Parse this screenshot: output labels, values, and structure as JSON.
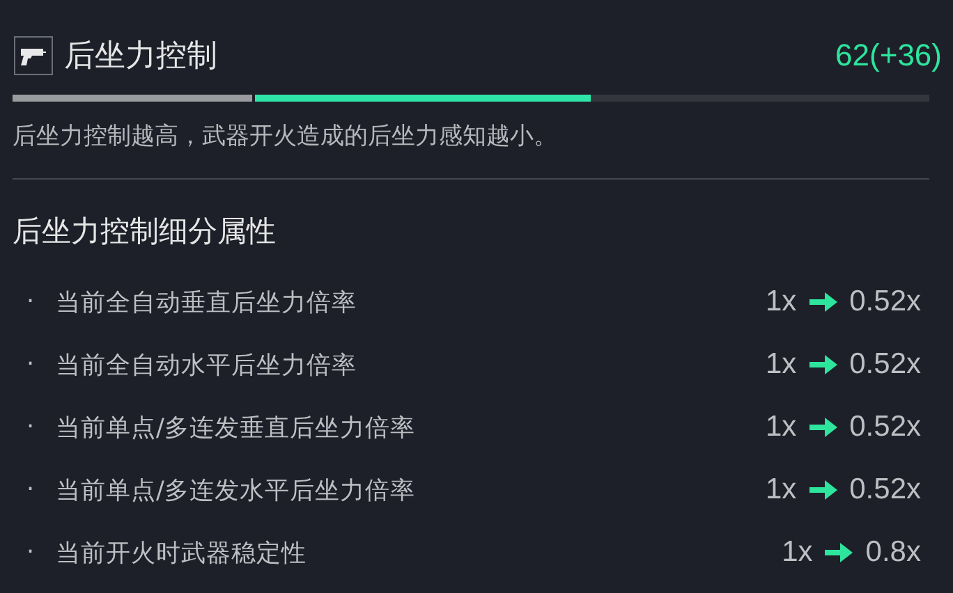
{
  "header": {
    "title": "后坐力控制",
    "value": "62(+36)"
  },
  "bar": {
    "segments": [
      {
        "kind": "base",
        "level": 0.265
      },
      {
        "kind": "bonus",
        "level": 0.365
      }
    ]
  },
  "description": "后坐力控制越高，武器开火造成的后坐力感知越小。",
  "section": {
    "title": "后坐力控制细分属性",
    "rows": [
      {
        "bullet": "·",
        "label": "当前全自动垂直后坐力倍率",
        "from": "1x",
        "to": "0.52x"
      },
      {
        "bullet": "·",
        "label": "当前全自动水平后坐力倍率",
        "from": "1x",
        "to": "0.52x"
      },
      {
        "bullet": "·",
        "label": "当前单点/多连发垂直后坐力倍率",
        "from": "1x",
        "to": "0.52x"
      },
      {
        "bullet": "·",
        "label": "当前单点/多连发水平后坐力倍率",
        "from": "1x",
        "to": "0.52x"
      },
      {
        "bullet": "·",
        "label": "当前开火时武器稳定性",
        "from": "1x",
        "to": "0.8x"
      }
    ]
  }
}
